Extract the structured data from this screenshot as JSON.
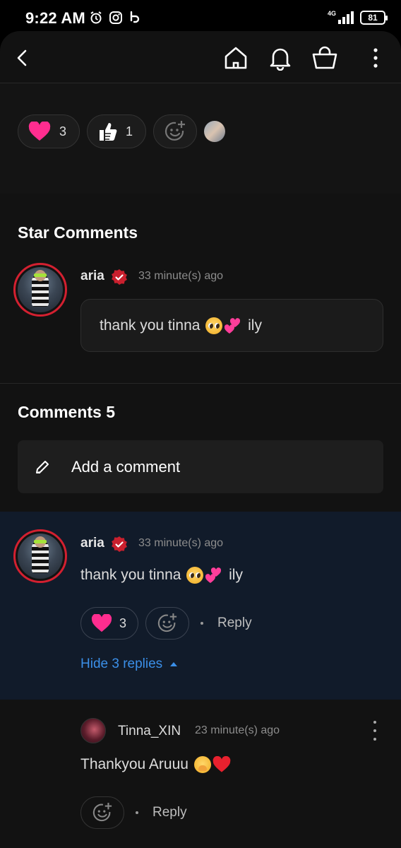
{
  "status_bar": {
    "time": "9:22 AM",
    "network": "4G",
    "battery": "81",
    "icons": [
      "alarm-icon",
      "instagram-icon",
      "app-notification-icon",
      "signal-icon",
      "battery-icon"
    ]
  },
  "topbar": {
    "icons": [
      "back-icon",
      "home-icon",
      "bell-icon",
      "shopping-bag-icon",
      "more-icon"
    ]
  },
  "reactions": {
    "heart_count": "3",
    "thumbs_count": "1",
    "icons": [
      "heart-icon",
      "thumbs-up-icon",
      "add-reaction-icon",
      "reactor-avatar"
    ]
  },
  "star_comments": {
    "title": "Star Comments",
    "comment": {
      "username": "aria",
      "time": "33 minute(s) ago",
      "text_before": "thank you tinna ",
      "text_after": " ily"
    }
  },
  "comments": {
    "title": "Comments 5",
    "add_placeholder": "Add a comment",
    "items": [
      {
        "username": "aria",
        "time": "33 minute(s) ago",
        "text_before": "thank you tinna ",
        "text_after": " ily",
        "heart_count": "3",
        "reply_label": "Reply",
        "hide_replies_label": "Hide 3 replies"
      }
    ],
    "replies": [
      {
        "username": "Tinna_XIN",
        "time": "23 minute(s) ago",
        "text": "Thankyou Aruuu ",
        "reply_label": "Reply"
      }
    ]
  },
  "colors": {
    "background": "#121212",
    "highlight": "#111b2a",
    "accent_red": "#d32030",
    "link_blue": "#3b8fe8",
    "heart_pink": "#ff2d8f"
  }
}
